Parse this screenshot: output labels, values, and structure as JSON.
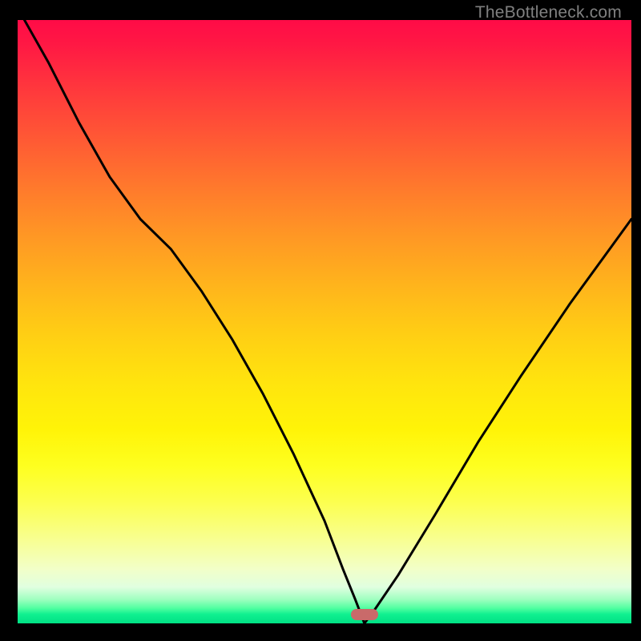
{
  "attribution": "TheBottleneck.com",
  "marker": {
    "x_frac": 0.565,
    "y_frac": 0.985,
    "color": "#c96a6a"
  },
  "chart_data": {
    "type": "line",
    "title": "",
    "xlabel": "",
    "ylabel": "",
    "xlim": [
      0,
      1
    ],
    "ylim": [
      0,
      1
    ],
    "grid": false,
    "background": "vertical-gradient red→orange→yellow→green",
    "series": [
      {
        "name": "bottleneck-curve",
        "x": [
          0.0,
          0.05,
          0.1,
          0.15,
          0.2,
          0.25,
          0.3,
          0.35,
          0.4,
          0.45,
          0.5,
          0.53,
          0.55,
          0.565,
          0.58,
          0.62,
          0.68,
          0.75,
          0.82,
          0.9,
          1.0
        ],
        "values": [
          1.02,
          0.93,
          0.83,
          0.74,
          0.67,
          0.62,
          0.55,
          0.47,
          0.38,
          0.28,
          0.17,
          0.09,
          0.04,
          0.0,
          0.02,
          0.08,
          0.18,
          0.3,
          0.41,
          0.53,
          0.67
        ]
      }
    ],
    "annotations": [
      {
        "type": "marker-pill",
        "x": 0.565,
        "y": 0.0,
        "color": "#c96a6a"
      }
    ]
  }
}
